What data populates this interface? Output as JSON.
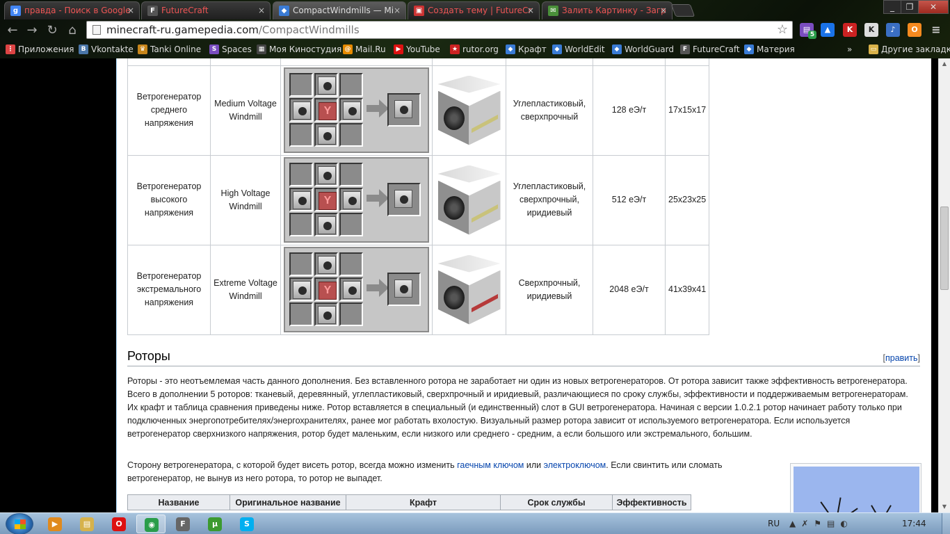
{
  "browser": {
    "tabs": [
      {
        "title": "правда - Поиск в Google",
        "icon_color": "#4285f4",
        "icon_letter": "g"
      },
      {
        "title": "FutureCraft",
        "icon_color": "#555555",
        "icon_letter": "F"
      },
      {
        "title": "CompactWindmills — Mi",
        "icon_color": "#3a7bd5",
        "icon_letter": "◆"
      },
      {
        "title": "Создать тему | FutureCr",
        "icon_color": "#cc3333",
        "icon_letter": "▣"
      },
      {
        "title": "Залить Картинку - Загр",
        "icon_color": "#4a8f3a",
        "icon_letter": "✉"
      }
    ],
    "address": {
      "host": "minecraft-ru.gamepedia.com",
      "path": "/CompactWindmills"
    },
    "extension_badge": "5",
    "bookmarks": [
      {
        "label": "Приложения",
        "icon": "apps-icon",
        "color": "#d44"
      },
      {
        "label": "Vkontakte",
        "icon": "vk-icon",
        "color": "#4a76a8"
      },
      {
        "label": "Tanki Online",
        "icon": "tanki-icon",
        "color": "#c8861b"
      },
      {
        "label": "Spaces",
        "icon": "spaces-icon",
        "color": "#7a4dbf"
      },
      {
        "label": "Моя Киностудия",
        "icon": "film-icon",
        "color": "#444"
      },
      {
        "label": "Mail.Ru",
        "icon": "mailru-icon",
        "color": "#e68a00"
      },
      {
        "label": "YouTube",
        "icon": "youtube-icon",
        "color": "#d11"
      },
      {
        "label": "rutor.org",
        "icon": "rutor-icon",
        "color": "#c22"
      },
      {
        "label": "Крафт",
        "icon": "cube-icon",
        "color": "#3a7bd5"
      },
      {
        "label": "WorldEdit",
        "icon": "cube-icon",
        "color": "#3a7bd5"
      },
      {
        "label": "WorldGuard",
        "icon": "cube-icon",
        "color": "#3a7bd5"
      },
      {
        "label": "FutureCraft",
        "icon": "futurecraft-icon",
        "color": "#555"
      },
      {
        "label": "Материя",
        "icon": "cube-icon",
        "color": "#3a7bd5"
      }
    ],
    "more_bookmarks_chevron": "»",
    "other_bookmarks": "Другие закладки"
  },
  "windmills": [
    {
      "name": "Ветрогенератор среднего напряжения",
      "original": "Medium Voltage Windmill",
      "rotors": "Углепластиковый, сверхпрочный",
      "output": "128 еЭ/т",
      "size": "17x15x17",
      "trim": "yellow"
    },
    {
      "name": "Ветрогенератор высокого напряжения",
      "original": "High Voltage Windmill",
      "rotors": "Углепластиковый, сверхпрочный, иридиевый",
      "output": "512 еЭ/т",
      "size": "25x23x25",
      "trim": "yellow"
    },
    {
      "name": "Ветрогенератор экстремального напряжения",
      "original": "Extreme Voltage Windmill",
      "rotors": "Сверхпрочный, иридиевый",
      "output": "2048 еЭ/т",
      "size": "41x39x41",
      "trim": "red"
    }
  ],
  "rotors_section": {
    "heading": "Роторы",
    "edit_open": "[",
    "edit_link": "править",
    "edit_close": "]",
    "para1": "Роторы - это неотъемлемая часть данного дополнения. Без вставленного ротора не заработает ни один из новых ветрогенераторов. От ротора зависит также эффективность ветрогенератора. Всего в дополнении 5 роторов: тканевый, деревянный, углепластиковый, сверхпрочный и иридиевый, различающиеся по сроку службы, эффективности и поддерживаемым ветрогенераторам. Их крафт и таблица сравнения приведены ниже. Ротор вставляется в специальный (и единственный) слот в GUI ветрогенератора. Начиная с версии 1.0.2.1 ротор начинает работу только при подключенных энергопотребителях/энергохранителях, ранее мог работать вхолостую. Визуальный размер ротора зависит от используемого ветрогенератора. Если используется ветрогенератор сверхнизкого напряжения, ротор будет маленьким, если низкого или среднего - средним, а если большого или экстремального, большим.",
    "para2_a": "Сторону ветрогенератора, с которой будет висеть ротор, всегда можно изменить ",
    "para2_link1": "гаечным ключом",
    "para2_b": " или ",
    "para2_link2": "электроключом",
    "para2_c": ". Если свинтить или сломать ветрогенератор, не вынув из него ротора, то ротор не выпадет.",
    "table_headers": [
      "Название",
      "Оригинальное название",
      "Крафт",
      "Срок службы",
      "Эффективность"
    ]
  },
  "taskbar": {
    "apps": [
      {
        "name": "media-player-icon",
        "color": "#e08a1e",
        "glyph": "▶"
      },
      {
        "name": "explorer-icon",
        "color": "#d6b24c",
        "glyph": "▤"
      },
      {
        "name": "opera-icon",
        "color": "#d11",
        "glyph": "O"
      },
      {
        "name": "chrome-icon",
        "color": "#2a9d4a",
        "glyph": "◉"
      },
      {
        "name": "futurecraft-launcher-icon",
        "color": "#666",
        "glyph": "F"
      },
      {
        "name": "utorrent-icon",
        "color": "#3c9a2f",
        "glyph": "µ"
      },
      {
        "name": "skype-icon",
        "color": "#00aff0",
        "glyph": "S"
      }
    ],
    "lang": "RU",
    "time": "17:44"
  }
}
